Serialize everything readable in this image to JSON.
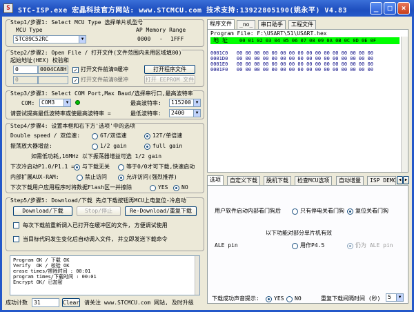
{
  "window": {
    "title": "STC-ISP.exe   宏晶科技官方网站: www.STCMCU.com  技术支持:13922805190(姚永平)  V4.83",
    "icon_text": "S",
    "min": "_",
    "max": "□",
    "close": "×"
  },
  "step1": {
    "title": "Step1/步骤1: Select MCU Type  选择单片机型号",
    "mcu_type_label": "MCU Type",
    "ap_memory_label": "AP Memory Range",
    "mcu_value": "STC89C52RC",
    "mem_start": "0000",
    "mem_dash": "-",
    "mem_end": "1FFF"
  },
  "step2": {
    "title": "Step2/步骤2: Open File / 打开文件(文件范围内未用区域填00)",
    "start_addr_label": "起始地址(HEX) 校验和",
    "addr1": "0",
    "checksum1": "0004CA8H",
    "addr2": "0",
    "chk1_label": "打开文件前清0缓冲",
    "chk2_label": "打开文件前清0缓冲",
    "open_prog_btn": "打开程序文件",
    "open_eeprom_btn": "打开 EEPROM 文件"
  },
  "step3": {
    "title": "Step3/步骤3: Select COM Port,Max Baud/选择串行口,最高波特率",
    "com_label": "COM:",
    "com_value": "COM3",
    "max_baud_label": "最高波特率:",
    "max_baud_value": "115200",
    "try_label": "请尝试提高最低波特率或使最高波特率 =",
    "min_baud_label": "最低波特率:",
    "min_baud_value": "2400"
  },
  "step4": {
    "title": "Step4/步骤4: 设置本框和右下方'选项'中的选项",
    "ds_label": "Double speed / 双倍速:",
    "ds_opt1": "6T/双倍速",
    "ds_opt2": "12T/单倍速",
    "osc_label": "振荡放大器增益:",
    "osc_opt1": "1/2 gain",
    "osc_opt2": "full gain",
    "osc_note": "如需低功耗,16MHz 以下振荡器增益可选 1/2 gain",
    "p1_label": "下次冷启动P1.0/P1.1 =",
    "p1_opt1": "与下载无关",
    "p1_opt2": "等于0/0才可下载,快速启动",
    "aux_label": "内部扩展AUX-RAM:",
    "aux_opt1": "禁止访问",
    "aux_opt2": "允许访问(强烈推荐)",
    "flash_label": "下次下载用户应用程序时将数据Flash区一并擦除",
    "flash_yes": "YES",
    "flash_no": "NO"
  },
  "step5": {
    "title": "Step5/步骤5: Download/下载  先点下载按钮再MCU上电复位-冷启动",
    "download_btn": "Download/下载",
    "stop_btn": "Stop/停止",
    "redownload_btn": "Re-Download/重复下载",
    "chk1_label": "每次下载前重新调入已打开在缓冲区的文件, 方便调试使用",
    "chk2_label": "当目标代码发生变化后自动调入文件, 并立即发送下载命令"
  },
  "log": {
    "lines": [
      "Program OK / 下载 OK",
      "Verify  OK / 校验 OK",
      "erase times/擦除时间 : 00:01",
      "program times/下载时间 : 00:01",
      "Encrypt OK/ 已加密"
    ]
  },
  "status": {
    "count_label": "成功计数",
    "count_value": "31",
    "clear_btn": "Clear",
    "footer": "请关注 www.STCMCU.com 网站, 及时升级"
  },
  "right_top": {
    "tabs": [
      "程序文件",
      "_no_",
      "串口助手",
      "工程文件"
    ],
    "file_label": "Program File: F:\\USART\\51\\USART.hex",
    "addr_header": "地 址",
    "col_header": "00 01 02 03 04 05 06 07 08 09 0A 0B 0C 0D 0E 0F",
    "rows": [
      "0001C0   00 00 00 00 00 00 00 00 00 00 00 00 00 00 00 00",
      "0001D0   00 00 00 00 00 00 00 00 00 00 00 00 00 00 00 00",
      "0001E0   00 00 00 00 00 00 00 00 00 00 00 00 00 00 00 00",
      "0001F0   00 00 00 00 00 00 00 00 00 00 00 00 00 00 00 00"
    ]
  },
  "right_bottom": {
    "tabs": [
      "选项",
      "自定义下载",
      "脱机下载",
      "检查MCU选项",
      "自动增量",
      "ISP DEMO"
    ],
    "wdt_label": "用户软件启动内部看门狗后",
    "wdt_opt1": "只有停电关看门狗",
    "wdt_opt2": "复位关看门狗",
    "funcs_label": "以下功能对部分单片机有效",
    "ale_label": "ALE pin",
    "ale_opt1": "用作P4.5",
    "ale_opt2": "仍为 ALE pin",
    "sound_label": "下载成功声音提示:",
    "sound_yes": "YES",
    "sound_no": "NO",
    "interval_label": "重复下载间隔时间 (秒)",
    "interval_value": "5"
  }
}
